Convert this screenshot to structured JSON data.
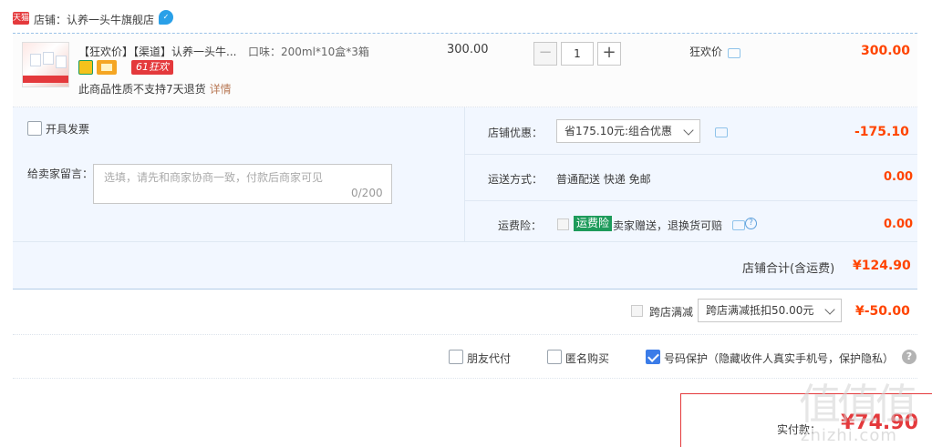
{
  "shop": {
    "badge": "天猫",
    "name": "店铺：认养一头牛旗舰店"
  },
  "item": {
    "title": "【狂欢价】【渠道】认养一头牛...",
    "spec": "口味：200ml*10盒*3箱",
    "tag_61": "61狂欢",
    "no_return": "此商品性质不支持7天退货",
    "detail_link": "详情",
    "unit_price": "300.00",
    "quantity": "1",
    "minus": "−",
    "plus": "+",
    "promo_label": "狂欢价",
    "total": "300.00"
  },
  "invoice": {
    "label": "开具发票"
  },
  "message": {
    "label": "给卖家留言：",
    "placeholder": "选填，请先和商家协商一致，付款后商家可见",
    "count": "0/200"
  },
  "shop_promo": {
    "label": "店铺优惠：",
    "selected": "省175.10元:组合优惠",
    "value": "-175.10"
  },
  "shipping": {
    "label": "运送方式：",
    "value": "普通配送 快递 免邮",
    "fee": "0.00"
  },
  "insurance": {
    "label": "运费险：",
    "badge": "运费险",
    "text": "卖家赠送，退换货可赔",
    "fee": "0.00"
  },
  "shop_total": {
    "label": "店铺合计(含运费)",
    "value": "¥124.90"
  },
  "cross_shop": {
    "label": "跨店满减",
    "selected": "跨店满减抵扣50.00元",
    "value": "¥-50.00"
  },
  "options": {
    "friend_pay": "朋友代付",
    "anonymous": "匿名购买",
    "phone_protect": "号码保护（隐藏收件人真实手机号，保护隐私）",
    "help": "?"
  },
  "pay": {
    "label": "实付款：",
    "value": "¥74.90"
  },
  "watermark": {
    "glyphs": "值值值",
    "text": "zhizhi.com"
  },
  "colors": {
    "price_red": "#ff4400",
    "accent_blue": "#3b7ce8",
    "panel_bg": "#f2f7ff",
    "tmall_red": "#e4393c",
    "insurance_green": "#1e9b5b"
  }
}
